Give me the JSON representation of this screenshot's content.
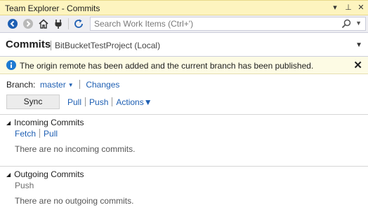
{
  "titlebar": {
    "title": "Team Explorer - Commits",
    "controls": {
      "dropdown": "▾",
      "pin": "⊥",
      "close": "✕"
    }
  },
  "toolbar": {
    "icons": [
      "back-icon",
      "forward-icon",
      "home-icon",
      "connect-plug-icon",
      "refresh-icon"
    ],
    "search_placeholder": "Search Work Items (Ctrl+')"
  },
  "header": {
    "title": "Commits",
    "subtitle": "BitBucketTestProject (Local)"
  },
  "info": {
    "message": "The origin remote has been added and the current branch has been published.",
    "close": "✕"
  },
  "branch": {
    "label": "Branch:",
    "name": "master",
    "changes": "Changes"
  },
  "sync": {
    "button": "Sync",
    "pull": "Pull",
    "push": "Push",
    "actions": "Actions"
  },
  "incoming": {
    "title": "Incoming Commits",
    "fetch": "Fetch",
    "pull": "Pull",
    "empty": "There are no incoming commits."
  },
  "outgoing": {
    "title": "Outgoing Commits",
    "push": "Push",
    "empty": "There are no outgoing commits."
  },
  "colors": {
    "titlebar_bg": "#fdf4bf",
    "info_bg": "#fdfbe4",
    "link": "#1e5fb3",
    "info_icon": "#1e7bd1"
  }
}
